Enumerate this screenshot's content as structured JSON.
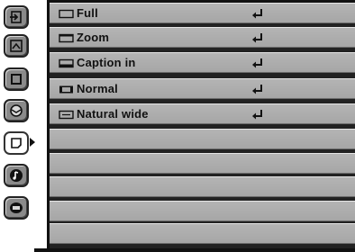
{
  "sidebar": {
    "tabs": [
      {
        "icon": "input-icon",
        "active": false
      },
      {
        "icon": "picture-adjust-icon",
        "active": false
      },
      {
        "icon": "image-icon",
        "active": false
      },
      {
        "icon": "color-icon",
        "active": false
      },
      {
        "icon": "screen-icon",
        "active": true
      },
      {
        "icon": "sound-icon",
        "active": false
      },
      {
        "icon": "setting-icon",
        "active": false
      }
    ]
  },
  "menu": {
    "items": [
      {
        "label": "Full",
        "icon": "full-aspect-icon",
        "action_icon": "enter-icon"
      },
      {
        "label": "Zoom",
        "icon": "zoom-aspect-icon",
        "action_icon": "enter-icon"
      },
      {
        "label": "Caption in",
        "icon": "caption-in-icon",
        "action_icon": "enter-icon"
      },
      {
        "label": "Normal",
        "icon": "normal-aspect-icon",
        "action_icon": "enter-icon"
      },
      {
        "label": "Natural wide",
        "icon": "natural-wide-icon",
        "action_icon": "enter-icon"
      }
    ],
    "empty_rows": 6
  },
  "colors": {
    "row_bg": "#a9a9a9",
    "rail_tab_bg": "#8a8a8a",
    "frame": "#111111"
  }
}
